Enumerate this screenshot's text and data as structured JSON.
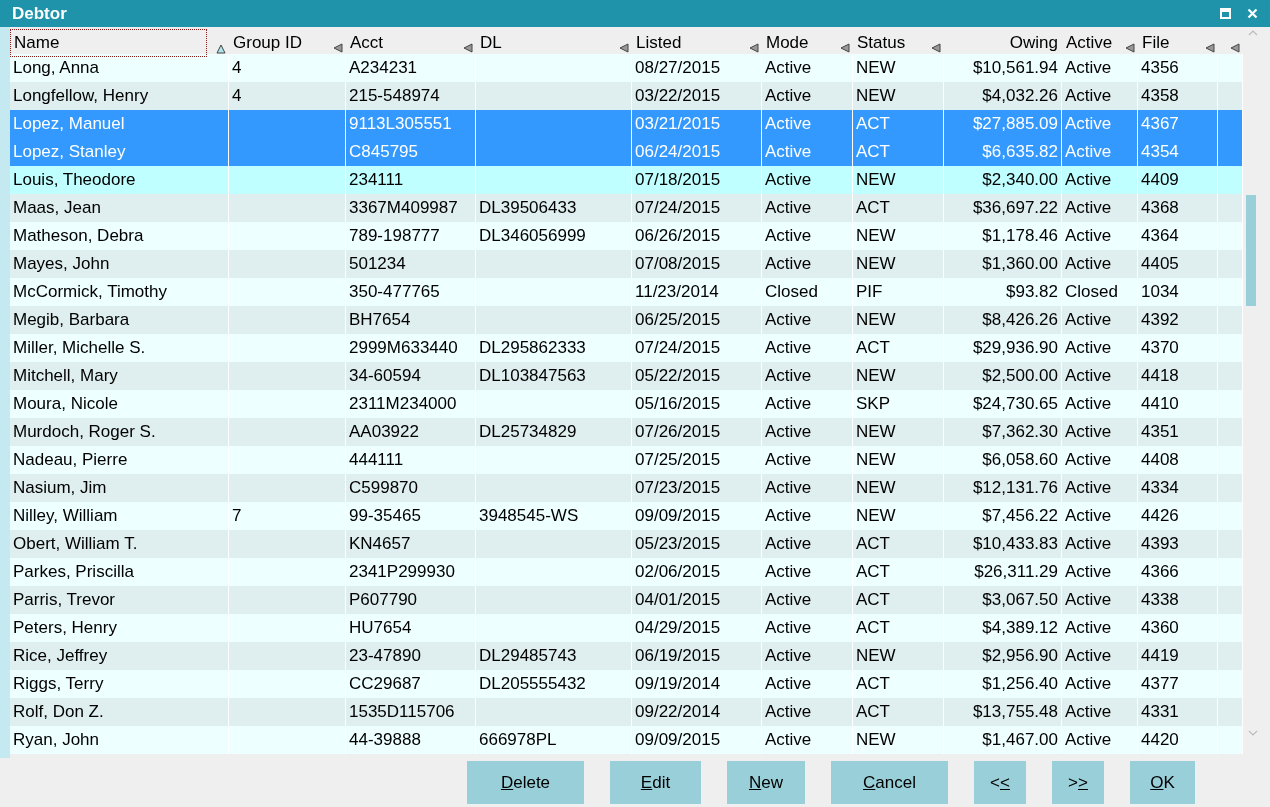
{
  "window": {
    "title": "Debtor"
  },
  "table": {
    "columns": [
      {
        "label": "Name",
        "kind": "text",
        "sorted": true,
        "sortable": true,
        "focused": true
      },
      {
        "label": "Group ID",
        "kind": "text",
        "sorted": false,
        "sortable": true,
        "focused": false
      },
      {
        "label": "Acct",
        "kind": "text",
        "sorted": false,
        "sortable": true,
        "focused": false
      },
      {
        "label": "DL",
        "kind": "text",
        "sorted": false,
        "sortable": true,
        "focused": false
      },
      {
        "label": "Listed",
        "kind": "text",
        "sorted": false,
        "sortable": true,
        "focused": false
      },
      {
        "label": "Mode",
        "kind": "text",
        "sorted": false,
        "sortable": true,
        "focused": false
      },
      {
        "label": "Status",
        "kind": "text",
        "sorted": false,
        "sortable": true,
        "focused": false
      },
      {
        "label": "Owing",
        "kind": "amount",
        "sorted": false,
        "sortable": false,
        "focused": false
      },
      {
        "label": "Active",
        "kind": "text",
        "sorted": false,
        "sortable": true,
        "focused": false
      },
      {
        "label": "File",
        "kind": "text",
        "sorted": false,
        "sortable": true,
        "focused": false
      },
      {
        "kind": "text",
        "sorted": false,
        "sortable": true,
        "focused": false
      }
    ],
    "rows": [
      {
        "selected": false,
        "highlighted": false,
        "cells": [
          "Long, Anna",
          "4",
          "A234231",
          null,
          "08/27/2015",
          "Active",
          "NEW",
          "$10,561.94",
          "Active",
          "4356"
        ]
      },
      {
        "selected": false,
        "highlighted": false,
        "cells": [
          "Longfellow, Henry",
          "4",
          "215-548974",
          null,
          "03/22/2015",
          "Active",
          "NEW",
          "$4,032.26",
          "Active",
          "4358"
        ]
      },
      {
        "selected": true,
        "highlighted": false,
        "cells": [
          "Lopez, Manuel",
          null,
          "9113L305551",
          null,
          "03/21/2015",
          "Active",
          "ACT",
          "$27,885.09",
          "Active",
          "4367"
        ]
      },
      {
        "selected": true,
        "highlighted": false,
        "cells": [
          "Lopez, Stanley",
          null,
          "C845795",
          null,
          "06/24/2015",
          "Active",
          "ACT",
          "$6,635.82",
          "Active",
          "4354"
        ]
      },
      {
        "selected": false,
        "highlighted": true,
        "cells": [
          "Louis, Theodore",
          null,
          "234111",
          null,
          "07/18/2015",
          "Active",
          "NEW",
          "$2,340.00",
          "Active",
          "4409"
        ]
      },
      {
        "selected": false,
        "highlighted": false,
        "cells": [
          "Maas, Jean",
          null,
          "3367M409987",
          "DL39506433",
          "07/24/2015",
          "Active",
          "ACT",
          "$36,697.22",
          "Active",
          "4368"
        ]
      },
      {
        "selected": false,
        "highlighted": false,
        "cells": [
          "Matheson, Debra",
          null,
          "789-198777",
          "DL346056999",
          "06/26/2015",
          "Active",
          "NEW",
          "$1,178.46",
          "Active",
          "4364"
        ]
      },
      {
        "selected": false,
        "highlighted": false,
        "cells": [
          "Mayes, John",
          null,
          "501234",
          null,
          "07/08/2015",
          "Active",
          "NEW",
          "$1,360.00",
          "Active",
          "4405"
        ]
      },
      {
        "selected": false,
        "highlighted": false,
        "cells": [
          "McCormick, Timothy",
          null,
          "350-477765",
          null,
          "11/23/2014",
          "Closed",
          "PIF",
          "$93.82",
          "Closed",
          "1034"
        ]
      },
      {
        "selected": false,
        "highlighted": false,
        "cells": [
          "Megib, Barbara",
          null,
          "BH7654",
          null,
          "06/25/2015",
          "Active",
          "NEW",
          "$8,426.26",
          "Active",
          "4392"
        ]
      },
      {
        "selected": false,
        "highlighted": false,
        "cells": [
          "Miller, Michelle S.",
          null,
          "2999M633440",
          "DL295862333",
          "07/24/2015",
          "Active",
          "ACT",
          "$29,936.90",
          "Active",
          "4370"
        ]
      },
      {
        "selected": false,
        "highlighted": false,
        "cells": [
          "Mitchell, Mary",
          null,
          "34-60594",
          "DL103847563",
          "05/22/2015",
          "Active",
          "NEW",
          "$2,500.00",
          "Active",
          "4418"
        ]
      },
      {
        "selected": false,
        "highlighted": false,
        "cells": [
          "Moura, Nicole",
          null,
          "2311M234000",
          null,
          "05/16/2015",
          "Active",
          "SKP",
          "$24,730.65",
          "Active",
          "4410"
        ]
      },
      {
        "selected": false,
        "highlighted": false,
        "cells": [
          "Murdoch, Roger S.",
          null,
          "AA03922",
          "DL25734829",
          "07/26/2015",
          "Active",
          "NEW",
          "$7,362.30",
          "Active",
          "4351"
        ]
      },
      {
        "selected": false,
        "highlighted": false,
        "cells": [
          "Nadeau, Pierre",
          null,
          "444111",
          null,
          "07/25/2015",
          "Active",
          "NEW",
          "$6,058.60",
          "Active",
          "4408"
        ]
      },
      {
        "selected": false,
        "highlighted": false,
        "cells": [
          "Nasium, Jim",
          null,
          "C599870",
          null,
          "07/23/2015",
          "Active",
          "NEW",
          "$12,131.76",
          "Active",
          "4334"
        ]
      },
      {
        "selected": false,
        "highlighted": false,
        "cells": [
          "Nilley, William",
          "7",
          "99-35465",
          "3948545-WS",
          "09/09/2015",
          "Active",
          "NEW",
          "$7,456.22",
          "Active",
          "4426"
        ]
      },
      {
        "selected": false,
        "highlighted": false,
        "cells": [
          "Obert, William T.",
          null,
          "KN4657",
          null,
          "05/23/2015",
          "Active",
          "ACT",
          "$10,433.83",
          "Active",
          "4393"
        ]
      },
      {
        "selected": false,
        "highlighted": false,
        "cells": [
          "Parkes, Priscilla",
          null,
          "2341P299930",
          null,
          "02/06/2015",
          "Active",
          "ACT",
          "$26,311.29",
          "Active",
          "4366"
        ]
      },
      {
        "selected": false,
        "highlighted": false,
        "cells": [
          "Parris, Trevor",
          null,
          "P607790",
          null,
          "04/01/2015",
          "Active",
          "ACT",
          "$3,067.50",
          "Active",
          "4338"
        ]
      },
      {
        "selected": false,
        "highlighted": false,
        "cells": [
          "Peters, Henry",
          null,
          "HU7654",
          null,
          "04/29/2015",
          "Active",
          "ACT",
          "$4,389.12",
          "Active",
          "4360"
        ]
      },
      {
        "selected": false,
        "highlighted": false,
        "cells": [
          "Rice, Jeffrey",
          null,
          "23-47890",
          "DL29485743",
          "06/19/2015",
          "Active",
          "NEW",
          "$2,956.90",
          "Active",
          "4419"
        ]
      },
      {
        "selected": false,
        "highlighted": false,
        "cells": [
          "Riggs, Terry",
          null,
          "CC29687",
          "DL205555432",
          "09/19/2014",
          "Active",
          "ACT",
          "$1,256.40",
          "Active",
          "4377"
        ]
      },
      {
        "selected": false,
        "highlighted": false,
        "cells": [
          "Rolf, Don Z.",
          null,
          "1535D115706",
          null,
          "09/22/2014",
          "Active",
          "ACT",
          "$13,755.48",
          "Active",
          "4331"
        ]
      },
      {
        "selected": false,
        "highlighted": false,
        "cells": [
          "Ryan, John",
          null,
          "44-39888",
          "666978PL",
          "09/09/2015",
          "Active",
          "NEW",
          "$1,467.00",
          "Active",
          "4420"
        ]
      }
    ]
  },
  "buttons": [
    {
      "label": "Delete",
      "shortcut_on_second_char": false
    },
    {
      "label": "Edit",
      "shortcut_on_second_char": false
    },
    {
      "label": "New",
      "shortcut_on_second_char": false
    },
    {
      "label": "Cancel",
      "shortcut_on_second_char": false
    },
    {
      "label": "<<",
      "shortcut_on_second_char": true
    },
    {
      "label": ">>",
      "shortcut_on_second_char": true
    },
    {
      "label": "OK",
      "shortcut_on_second_char": false
    }
  ]
}
